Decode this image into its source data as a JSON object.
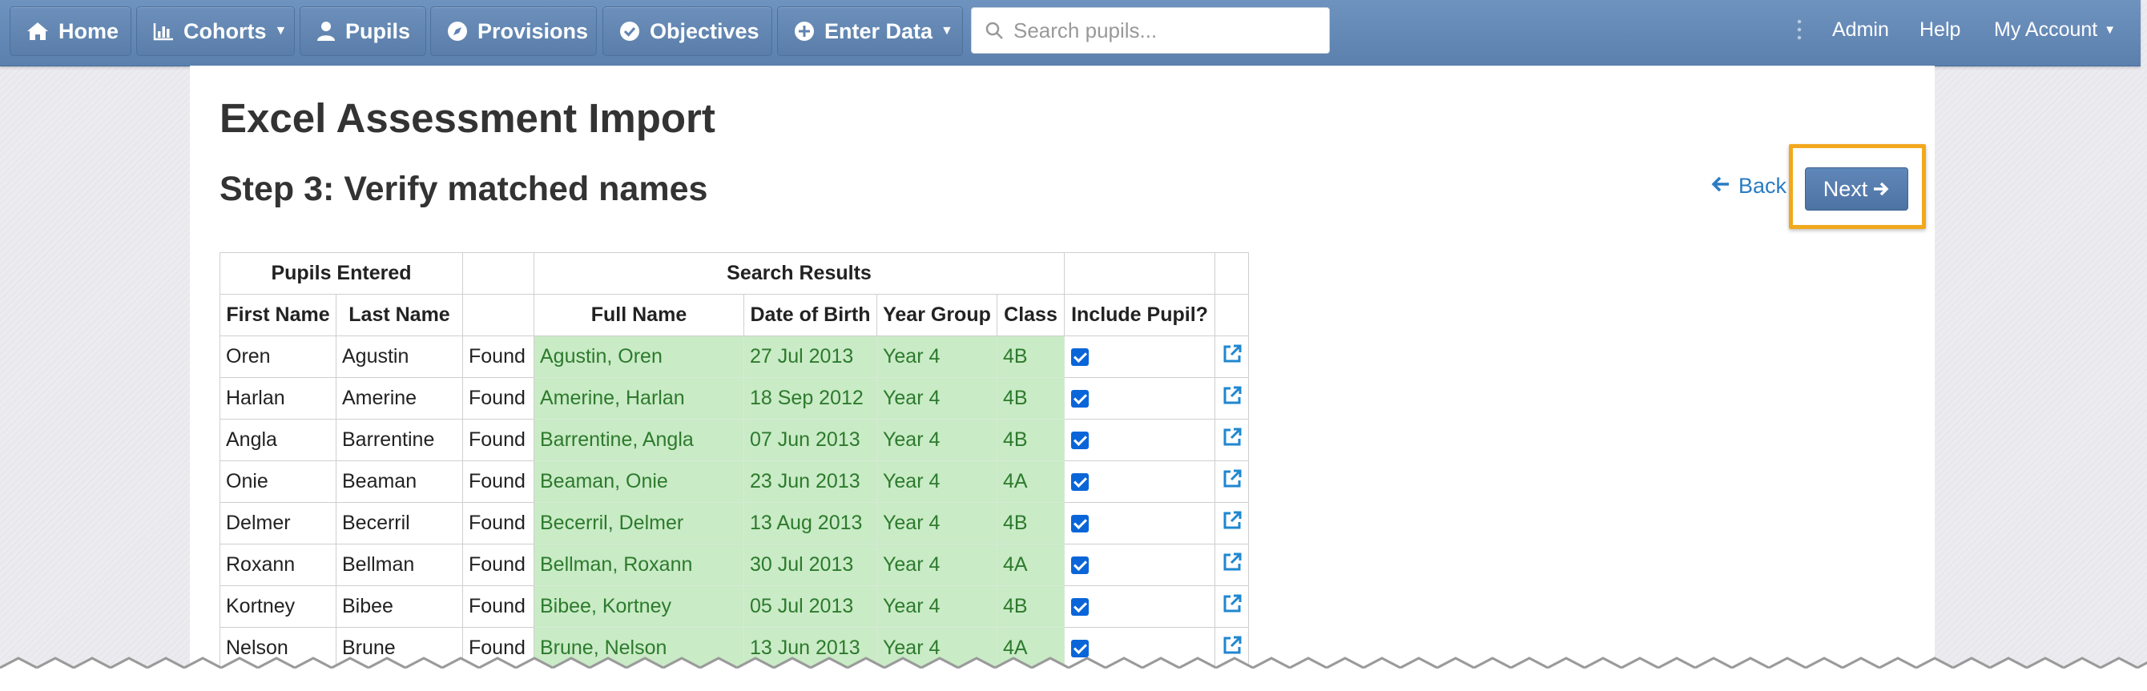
{
  "nav": {
    "home": "Home",
    "cohorts": "Cohorts",
    "pupils": "Pupils",
    "provisions": "Provisions",
    "objectives": "Objectives",
    "enter_data": "Enter Data",
    "search_placeholder": "Search pupils...",
    "admin": "Admin",
    "help": "Help",
    "my_account": "My Account"
  },
  "page": {
    "title": "Excel Assessment Import",
    "step": "Step 3: Verify matched names",
    "back": "Back",
    "next": "Next"
  },
  "table": {
    "group_headers": {
      "entered": "Pupils Entered",
      "results": "Search Results"
    },
    "columns": {
      "first_name": "First Name",
      "last_name": "Last Name",
      "full_name": "Full Name",
      "dob": "Date of Birth",
      "year_group": "Year Group",
      "class": "Class",
      "include": "Include Pupil?"
    },
    "rows": [
      {
        "first": "Oren",
        "last": "Agustin",
        "status": "Found",
        "full": "Agustin, Oren",
        "dob": "27 Jul 2013",
        "year": "Year 4",
        "class": "4B",
        "include": true
      },
      {
        "first": "Harlan",
        "last": "Amerine",
        "status": "Found",
        "full": "Amerine, Harlan",
        "dob": "18 Sep 2012",
        "year": "Year 4",
        "class": "4B",
        "include": true
      },
      {
        "first": "Angla",
        "last": "Barrentine",
        "status": "Found",
        "full": "Barrentine, Angla",
        "dob": "07 Jun 2013",
        "year": "Year 4",
        "class": "4B",
        "include": true
      },
      {
        "first": "Onie",
        "last": "Beaman",
        "status": "Found",
        "full": "Beaman, Onie",
        "dob": "23 Jun 2013",
        "year": "Year 4",
        "class": "4A",
        "include": true
      },
      {
        "first": "Delmer",
        "last": "Becerril",
        "status": "Found",
        "full": "Becerril, Delmer",
        "dob": "13 Aug 2013",
        "year": "Year 4",
        "class": "4B",
        "include": true
      },
      {
        "first": "Roxann",
        "last": "Bellman",
        "status": "Found",
        "full": "Bellman, Roxann",
        "dob": "30 Jul 2013",
        "year": "Year 4",
        "class": "4A",
        "include": true
      },
      {
        "first": "Kortney",
        "last": "Bibee",
        "status": "Found",
        "full": "Bibee, Kortney",
        "dob": "05 Jul 2013",
        "year": "Year 4",
        "class": "4B",
        "include": true
      },
      {
        "first": "Nelson",
        "last": "Brune",
        "status": "Found",
        "full": "Brune, Nelson",
        "dob": "13 Jun 2013",
        "year": "Year 4",
        "class": "4A",
        "include": true
      }
    ]
  },
  "colors": {
    "navbar": "#6285b3",
    "highlight": "#f2a81d",
    "match_bg": "#c9ebc6",
    "match_text": "#2d7a2d",
    "link": "#2a7bc2",
    "checkbox": "#0a65d8"
  }
}
